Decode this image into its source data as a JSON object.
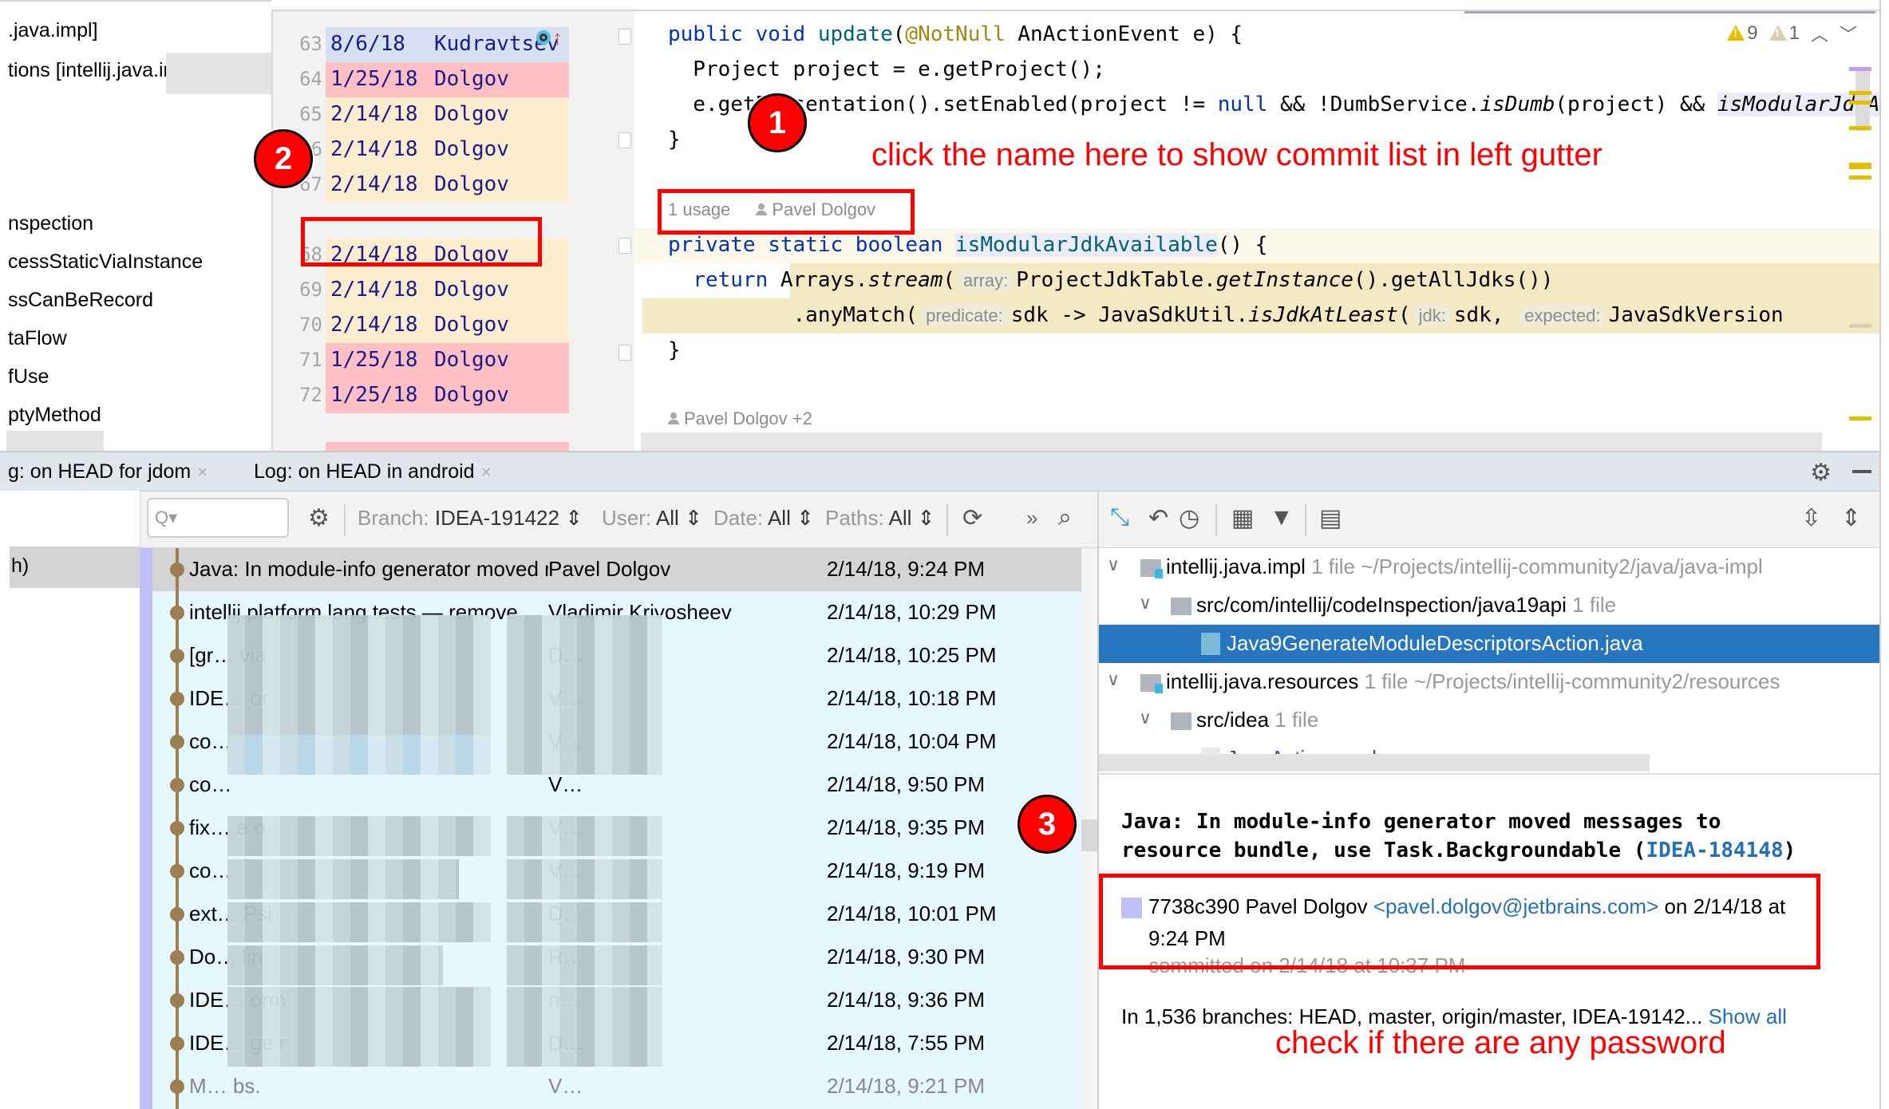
{
  "project_tree": {
    "items": [
      ".java.impl]",
      "tions [intellij.java.impl.insp",
      "nspection",
      "cessStaticViaInstance",
      "ssCanBeRecord",
      "taFlow",
      "fUse",
      "ptyMethod"
    ]
  },
  "annotations": [
    {
      "line": "63",
      "date": "8/6/18",
      "author": "Kudravtsev",
      "color": "blue"
    },
    {
      "line": "64",
      "date": "1/25/18",
      "author": "Dolgov",
      "color": "pink"
    },
    {
      "line": "65",
      "date": "2/14/18",
      "author": "Dolgov",
      "color": "cream"
    },
    {
      "line": "66",
      "date": "2/14/18",
      "author": "Dolgov",
      "color": "cream"
    },
    {
      "line": "67",
      "date": "2/14/18",
      "author": "Dolgov",
      "color": "cream"
    },
    {
      "line": "68",
      "date": "2/14/18",
      "author": "Dolgov",
      "color": "cream"
    },
    {
      "line": "69",
      "date": "2/14/18",
      "author": "Dolgov",
      "color": "cream"
    },
    {
      "line": "70",
      "date": "2/14/18",
      "author": "Dolgov",
      "color": "cream"
    },
    {
      "line": "71",
      "date": "1/25/18",
      "author": "Dolgov",
      "color": "pink"
    },
    {
      "line": "72",
      "date": "1/25/18",
      "author": "Dolgov",
      "color": "pink"
    }
  ],
  "editor": {
    "inspections": {
      "warnings": "9",
      "weak_warnings": "1"
    },
    "codelens_usage": "1 usage",
    "codelens_author": "Pavel Dolgov",
    "codelens_author_bottom": "Pavel Dolgov +2",
    "hints": {
      "array": "array:",
      "predicate": "predicate:",
      "jdk": "jdk:",
      "expected": "expected:"
    },
    "lines": {
      "l1_kw": "public void ",
      "l1_fn": "update",
      "l1_p": "(",
      "l1_ann": "@NotNull",
      "l1_rest": " AnActionEvent e) {",
      "l2": "  Project project = e.getProject();",
      "l3_a": "  e.getPresentation().setEnabled(project != ",
      "l3_null": "null",
      "l3_b": " && !DumbService.",
      "l3_isdumb": "isDumb",
      "l3_c": "(project) && ",
      "l3_ismod": "isModularJdkAvailable",
      "l4": "}",
      "l5_kw": "private static boolean ",
      "l5_fn": "isModularJdkAvailable",
      "l5_rest": "() {",
      "l6_kw": "  return ",
      "l6_a": "Arrays.",
      "l6_stream": "stream",
      "l6_p": "(",
      "l6_b": "ProjectJdkTable.",
      "l6_gi": "getInstance",
      "l6_c": "().getAllJdks())",
      "l7_a": "          .anyMatch(",
      "l7_b": "sdk -> JavaSdkUtil.",
      "l7_isjdk": "isJdkAtLeast",
      "l7_p": "(",
      "l7_c": "sdk,",
      "l7_d": "JavaSdkVersion",
      "l8": "}"
    }
  },
  "callouts": {
    "badge1": "1",
    "badge2": "2",
    "badge3": "3",
    "note1": "click the name here to show commit list in left gutter",
    "note3": "check if there are any password"
  },
  "tool_window": {
    "tabs": [
      {
        "label": "g: on HEAD for jdom",
        "close": "×"
      },
      {
        "label": "Log: on HEAD in android",
        "close": "×"
      }
    ],
    "branch_selected": "h)",
    "toolbar": {
      "search_placeholder": "Q▾",
      "branch_label": "Branch:",
      "branch_value": "IDEA-191422",
      "user_label": "User:",
      "user_value": "All",
      "date_label": "Date:",
      "date_value": "All",
      "paths_label": "Paths:",
      "paths_value": "All",
      "more": "»"
    }
  },
  "commits": [
    {
      "message": "Java: In module-info generator moved messages to resource bundle",
      "author": "Pavel Dolgov",
      "date": "2/14/18, 9:24 PM",
      "selected": true
    },
    {
      "message": "intellij.platform.lang.tests — remove",
      "author": "Vladimir Krivosheev",
      "date": "2/14/18, 10:29 PM"
    },
    {
      "message": "[gr… via",
      "author": "D…",
      "date": "2/14/18, 10:25 PM"
    },
    {
      "message": "IDE… or",
      "author": "V…",
      "date": "2/14/18, 10:18 PM"
    },
    {
      "message": "co…",
      "author": "V…",
      "date": "2/14/18, 10:04 PM"
    },
    {
      "message": "co…",
      "author": "V…",
      "date": "2/14/18, 9:50 PM"
    },
    {
      "message": "fix… e o",
      "author": "V…",
      "date": "2/14/18, 9:35 PM"
    },
    {
      "message": "co…",
      "author": "V…",
      "date": "2/14/18, 9:19 PM"
    },
    {
      "message": "ext… Psi",
      "author": "D…",
      "date": "2/14/18, 10:01 PM"
    },
    {
      "message": "Do… lin",
      "author": "R…",
      "date": "2/14/18, 9:30 PM"
    },
    {
      "message": "IDE… orm",
      "author": "n…",
      "date": "2/14/18, 9:36 PM"
    },
    {
      "message": "IDE… ge r",
      "author": "D…",
      "date": "2/14/18, 7:55 PM"
    },
    {
      "message": "M… bs.",
      "author": "V…",
      "date": "2/14/18, 9:21 PM",
      "dim": true
    }
  ],
  "changes": {
    "rows": [
      {
        "label": "intellij.java.impl",
        "meta": "1 file  ~/Projects/intellij-community2/java/java-impl"
      },
      {
        "label": "src/com/intellij/codeInspection/java19api",
        "meta": "1 file"
      },
      {
        "label": "Java9GenerateModuleDescriptorsAction.java",
        "meta": ""
      },
      {
        "label": "intellij.java.resources",
        "meta": "1 file  ~/Projects/intellij-community2/resources"
      },
      {
        "label": "src/idea",
        "meta": "1 file"
      },
      {
        "label": "JavaActions.xml",
        "meta": ""
      }
    ]
  },
  "details": {
    "title_line1": "Java: In module-info generator moved messages to",
    "title_line2": "resource bundle, use Task.Backgroundable (",
    "issue_link": "IDEA-184148",
    "title_close": ")",
    "hash_author": "7738c390 Pavel Dolgov ",
    "email": "<pavel.dolgov@jetbrains.com>",
    "on_date": " on 2/14/18 at",
    "time": "9:24 PM",
    "committed": "committed on 2/14/18 at 10:37 PM",
    "branches": "In 1,536 branches: HEAD, master, origin/master, IDEA-19142... ",
    "show_all": "Show all"
  },
  "colors": {
    "annotation_blue": "#d7e0f0",
    "annotation_pink": "#ffc0c4",
    "annotation_cream": "#fdedcf",
    "callout_red": "#ff0000",
    "selection_blue": "#2675bf",
    "graph_brown": "#9c7f51",
    "log_bg": "#e4f8fe"
  }
}
